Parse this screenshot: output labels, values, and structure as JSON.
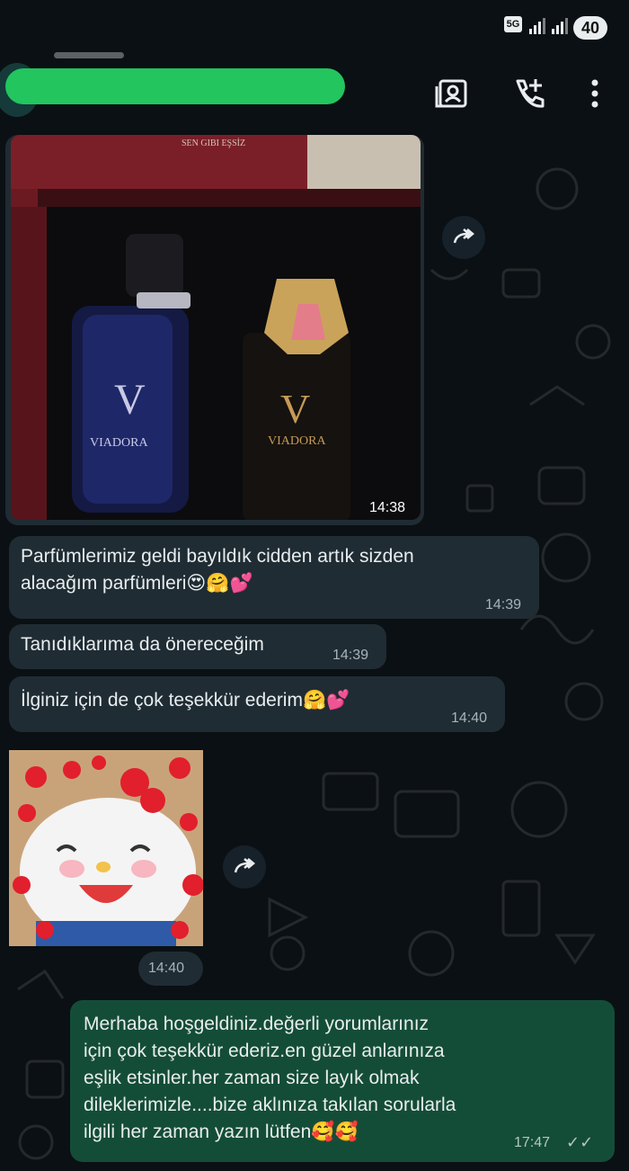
{
  "status_bar": {
    "network": "5G",
    "battery": "40"
  },
  "header": {
    "contact_name": ""
  },
  "messages": [
    {
      "type": "image",
      "time": "14:38",
      "box_text": "SEN GIBI EŞSİZ",
      "bottle_left": "VIADORA",
      "bottle_right": "VIADORA"
    },
    {
      "type": "text",
      "text": "Parfümlerimiz geldi bayıldık cidden artık sizden\nalacağım parfümleri😍🤗💕",
      "time": "14:39"
    },
    {
      "type": "text",
      "text": "Tanıdıklarıma da önereceğim",
      "time": "14:39"
    },
    {
      "type": "text",
      "text": "İlginiz için de çok teşekkür ederim🤗💕",
      "time": "14:40"
    },
    {
      "type": "sticker",
      "time": "14:40"
    },
    {
      "type": "text",
      "text": "Merhaba hoşgeldiniz.değerli yorumlarınız\niçin çok teşekkür ederiz.en güzel anlarınıza\neşlik etsinler.her zaman size layık olmak\ndileklerimizle....bize aklınıza takılan sorularla\nilgili her zaman yazın lütfen🥰🥰",
      "time": "17:47",
      "status": "✓✓"
    }
  ]
}
